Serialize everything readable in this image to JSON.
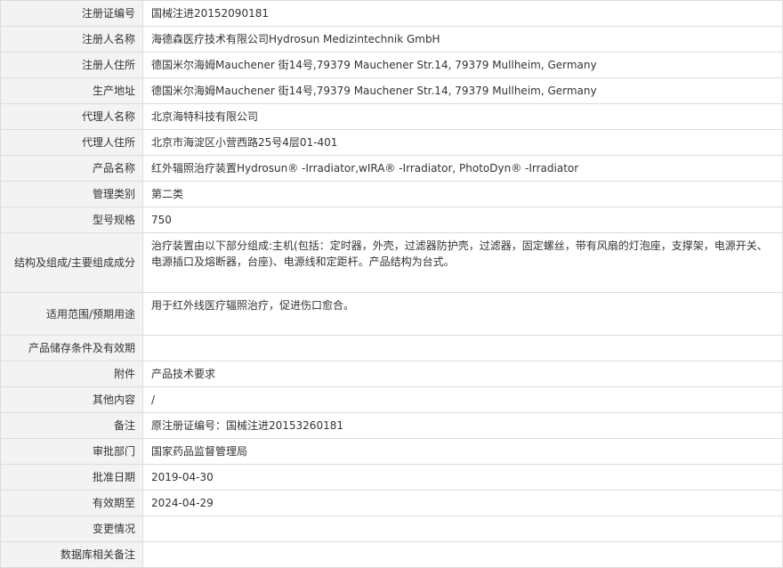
{
  "rows": [
    {
      "key": "reg_no",
      "label": "注册证编号",
      "value": "国械注进20152090181"
    },
    {
      "key": "registrant_name",
      "label": "注册人名称",
      "value": "海德森医疗技术有限公司Hydrosun Medizintechnik GmbH"
    },
    {
      "key": "registrant_address",
      "label": "注册人住所",
      "value": "德国米尔海姆Mauchener 街14号,79379 Mauchener Str.14, 79379 Mullheim, Germany"
    },
    {
      "key": "production_address",
      "label": "生产地址",
      "value": "德国米尔海姆Mauchener 街14号,79379 Mauchener Str.14, 79379 Mullheim, Germany"
    },
    {
      "key": "agent_name",
      "label": "代理人名称",
      "value": "北京海特科技有限公司"
    },
    {
      "key": "agent_address",
      "label": "代理人住所",
      "value": "北京市海淀区小营西路25号4层01-401"
    },
    {
      "key": "product_name",
      "label": "产品名称",
      "value": "红外辐照治疗装置Hydrosun® -Irradiator,wIRA® -Irradiator, PhotoDyn® -Irradiator"
    },
    {
      "key": "management_category",
      "label": "管理类别",
      "value": "第二类"
    },
    {
      "key": "model_spec",
      "label": "型号规格",
      "value": "750"
    },
    {
      "key": "structure",
      "label": "结构及组成/主要组成成分",
      "value": "治疗装置由以下部分组成:主机(包括：定时器，外壳，过滤器防护壳，过滤器，固定螺丝，带有风扇的灯泡座，支撑架，电源开关、电源插口及熔断器，台座)、电源线和定距杆。产品结构为台式。"
    },
    {
      "key": "intended_use",
      "label": "适用范围/预期用途",
      "value": "用于红外线医疗辐照治疗，促进伤口愈合。"
    },
    {
      "key": "storage",
      "label": "产品储存条件及有效期",
      "value": ""
    },
    {
      "key": "attachment",
      "label": "附件",
      "value": "产品技术要求"
    },
    {
      "key": "other",
      "label": "其他内容",
      "value": "/"
    },
    {
      "key": "remark",
      "label": "备注",
      "value": "原注册证编号：国械注进20153260181"
    },
    {
      "key": "approval_dept",
      "label": "审批部门",
      "value": "国家药品监督管理局"
    },
    {
      "key": "approval_date",
      "label": "批准日期",
      "value": "2019-04-30"
    },
    {
      "key": "valid_until",
      "label": "有效期至",
      "value": "2024-04-29"
    },
    {
      "key": "change",
      "label": "变更情况",
      "value": ""
    },
    {
      "key": "db_remark",
      "label": "数据库相关备注",
      "value": ""
    }
  ]
}
